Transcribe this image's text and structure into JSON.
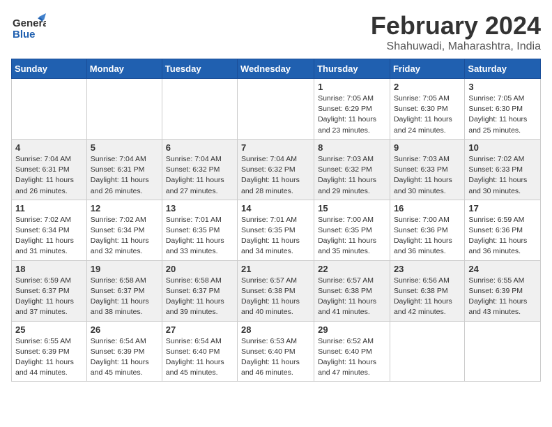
{
  "header": {
    "logo_general": "General",
    "logo_blue": "Blue",
    "month_title": "February 2024",
    "location": "Shahuwadi, Maharashtra, India"
  },
  "weekdays": [
    "Sunday",
    "Monday",
    "Tuesday",
    "Wednesday",
    "Thursday",
    "Friday",
    "Saturday"
  ],
  "weeks": [
    [
      {
        "day": "",
        "info": ""
      },
      {
        "day": "",
        "info": ""
      },
      {
        "day": "",
        "info": ""
      },
      {
        "day": "",
        "info": ""
      },
      {
        "day": "1",
        "info": "Sunrise: 7:05 AM\nSunset: 6:29 PM\nDaylight: 11 hours and 23 minutes."
      },
      {
        "day": "2",
        "info": "Sunrise: 7:05 AM\nSunset: 6:30 PM\nDaylight: 11 hours and 24 minutes."
      },
      {
        "day": "3",
        "info": "Sunrise: 7:05 AM\nSunset: 6:30 PM\nDaylight: 11 hours and 25 minutes."
      }
    ],
    [
      {
        "day": "4",
        "info": "Sunrise: 7:04 AM\nSunset: 6:31 PM\nDaylight: 11 hours and 26 minutes."
      },
      {
        "day": "5",
        "info": "Sunrise: 7:04 AM\nSunset: 6:31 PM\nDaylight: 11 hours and 26 minutes."
      },
      {
        "day": "6",
        "info": "Sunrise: 7:04 AM\nSunset: 6:32 PM\nDaylight: 11 hours and 27 minutes."
      },
      {
        "day": "7",
        "info": "Sunrise: 7:04 AM\nSunset: 6:32 PM\nDaylight: 11 hours and 28 minutes."
      },
      {
        "day": "8",
        "info": "Sunrise: 7:03 AM\nSunset: 6:32 PM\nDaylight: 11 hours and 29 minutes."
      },
      {
        "day": "9",
        "info": "Sunrise: 7:03 AM\nSunset: 6:33 PM\nDaylight: 11 hours and 30 minutes."
      },
      {
        "day": "10",
        "info": "Sunrise: 7:02 AM\nSunset: 6:33 PM\nDaylight: 11 hours and 30 minutes."
      }
    ],
    [
      {
        "day": "11",
        "info": "Sunrise: 7:02 AM\nSunset: 6:34 PM\nDaylight: 11 hours and 31 minutes."
      },
      {
        "day": "12",
        "info": "Sunrise: 7:02 AM\nSunset: 6:34 PM\nDaylight: 11 hours and 32 minutes."
      },
      {
        "day": "13",
        "info": "Sunrise: 7:01 AM\nSunset: 6:35 PM\nDaylight: 11 hours and 33 minutes."
      },
      {
        "day": "14",
        "info": "Sunrise: 7:01 AM\nSunset: 6:35 PM\nDaylight: 11 hours and 34 minutes."
      },
      {
        "day": "15",
        "info": "Sunrise: 7:00 AM\nSunset: 6:35 PM\nDaylight: 11 hours and 35 minutes."
      },
      {
        "day": "16",
        "info": "Sunrise: 7:00 AM\nSunset: 6:36 PM\nDaylight: 11 hours and 36 minutes."
      },
      {
        "day": "17",
        "info": "Sunrise: 6:59 AM\nSunset: 6:36 PM\nDaylight: 11 hours and 36 minutes."
      }
    ],
    [
      {
        "day": "18",
        "info": "Sunrise: 6:59 AM\nSunset: 6:37 PM\nDaylight: 11 hours and 37 minutes."
      },
      {
        "day": "19",
        "info": "Sunrise: 6:58 AM\nSunset: 6:37 PM\nDaylight: 11 hours and 38 minutes."
      },
      {
        "day": "20",
        "info": "Sunrise: 6:58 AM\nSunset: 6:37 PM\nDaylight: 11 hours and 39 minutes."
      },
      {
        "day": "21",
        "info": "Sunrise: 6:57 AM\nSunset: 6:38 PM\nDaylight: 11 hours and 40 minutes."
      },
      {
        "day": "22",
        "info": "Sunrise: 6:57 AM\nSunset: 6:38 PM\nDaylight: 11 hours and 41 minutes."
      },
      {
        "day": "23",
        "info": "Sunrise: 6:56 AM\nSunset: 6:38 PM\nDaylight: 11 hours and 42 minutes."
      },
      {
        "day": "24",
        "info": "Sunrise: 6:55 AM\nSunset: 6:39 PM\nDaylight: 11 hours and 43 minutes."
      }
    ],
    [
      {
        "day": "25",
        "info": "Sunrise: 6:55 AM\nSunset: 6:39 PM\nDaylight: 11 hours and 44 minutes."
      },
      {
        "day": "26",
        "info": "Sunrise: 6:54 AM\nSunset: 6:39 PM\nDaylight: 11 hours and 45 minutes."
      },
      {
        "day": "27",
        "info": "Sunrise: 6:54 AM\nSunset: 6:40 PM\nDaylight: 11 hours and 45 minutes."
      },
      {
        "day": "28",
        "info": "Sunrise: 6:53 AM\nSunset: 6:40 PM\nDaylight: 11 hours and 46 minutes."
      },
      {
        "day": "29",
        "info": "Sunrise: 6:52 AM\nSunset: 6:40 PM\nDaylight: 11 hours and 47 minutes."
      },
      {
        "day": "",
        "info": ""
      },
      {
        "day": "",
        "info": ""
      }
    ]
  ]
}
